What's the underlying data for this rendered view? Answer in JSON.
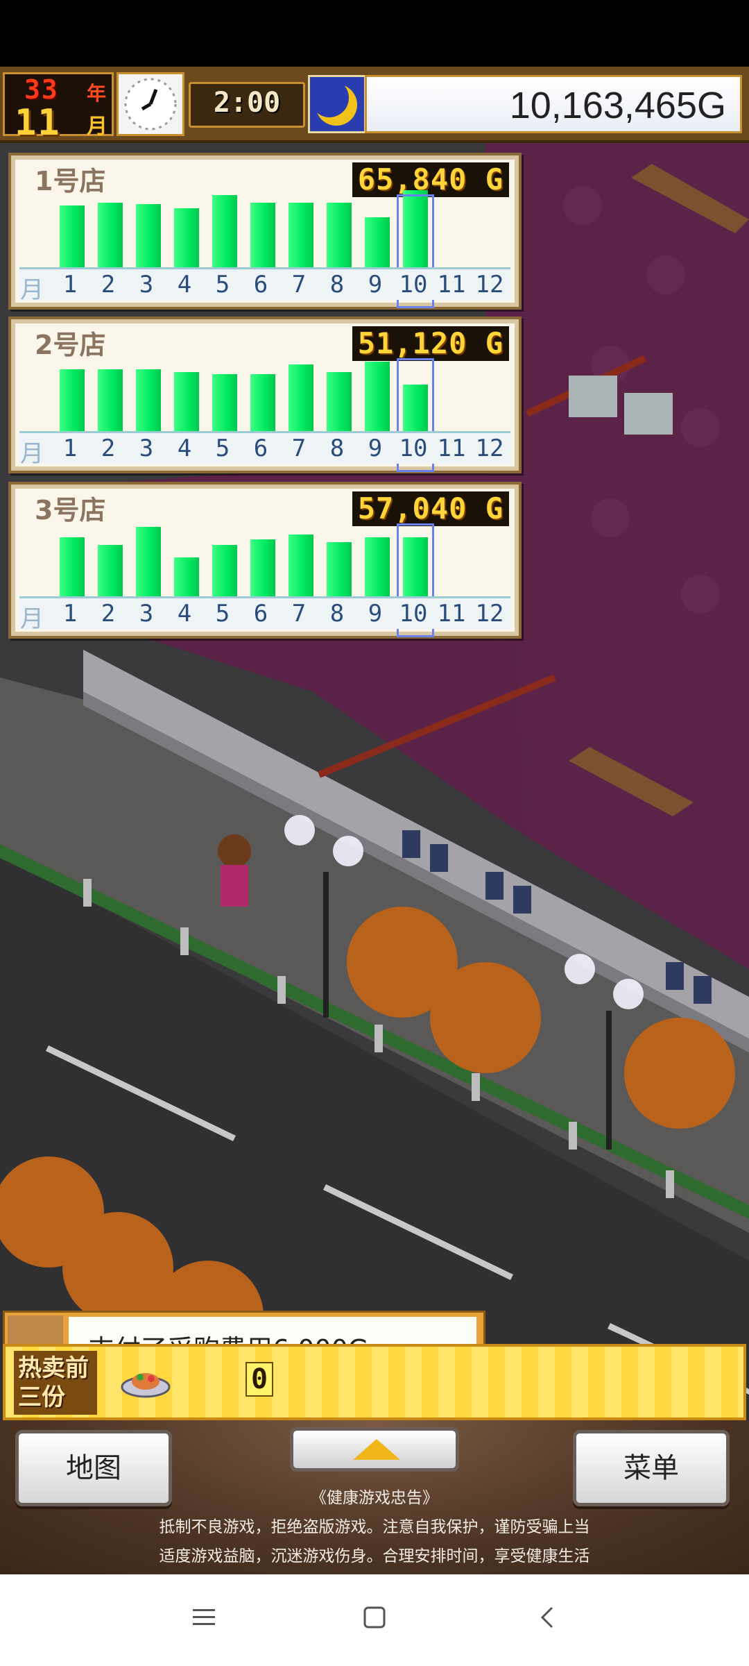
{
  "hud": {
    "year": "33",
    "year_unit": "年",
    "month": "11",
    "month_unit": "月",
    "time": "2:00",
    "money": "10,163,465G"
  },
  "stores": [
    {
      "name": "1号店",
      "total": "65,840 G",
      "monthly_sales_relative": [
        0.56,
        0.58,
        0.57,
        0.54,
        0.64,
        0.58,
        0.58,
        0.58,
        0.47,
        0.68,
        null,
        null
      ]
    },
    {
      "name": "2号店",
      "total": "51,120 G",
      "monthly_sales_relative": [
        0.56,
        0.56,
        0.56,
        0.54,
        0.52,
        0.52,
        0.6,
        0.54,
        0.62,
        0.44,
        null,
        null
      ]
    },
    {
      "name": "3号店",
      "total": "57,040 G",
      "monthly_sales_relative": [
        0.54,
        0.48,
        0.62,
        0.38,
        0.48,
        0.52,
        0.56,
        0.5,
        0.54,
        0.54,
        null,
        null
      ]
    }
  ],
  "month_axis": {
    "label": "月",
    "months": [
      "1",
      "2",
      "3",
      "4",
      "5",
      "6",
      "7",
      "8",
      "9",
      "10",
      "11",
      "12"
    ],
    "current_index": 9
  },
  "notice": {
    "text": "支付了采购费用6,000G"
  },
  "ranking": {
    "label": "热卖前三份",
    "count": "0"
  },
  "buttons": {
    "map": "地图",
    "menu": "菜单"
  },
  "health_notice": {
    "title": "《健康游戏忠告》",
    "line1": "抵制不良游戏，拒绝盗版游戏。注意自我保护，谨防受骗上当",
    "line2": "适度游戏益脑，沉迷游戏伤身。合理安排时间，享受健康生活"
  },
  "colors": {
    "bar": "#00e860",
    "current_month_outline": "#6a82f0",
    "hud_frame": "#c99030"
  },
  "icons": {
    "clock": "clock-icon",
    "moon": "moon-icon",
    "dish": "dish-icon",
    "nav_menu": "menu-icon",
    "nav_home": "home-icon",
    "nav_back": "back-icon"
  }
}
